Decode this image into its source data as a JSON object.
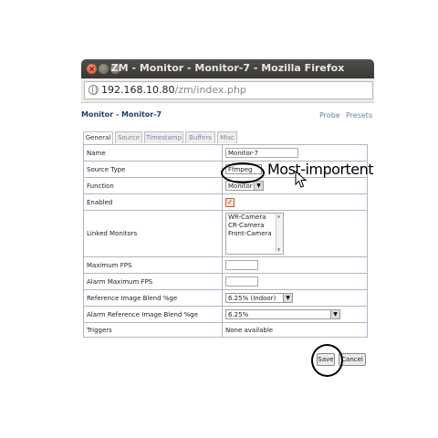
{
  "window": {
    "title": "ZM - Monitor - Monitor-7 - Mozilla Firefox",
    "url_host": "192.168.10.80",
    "url_path": "/zm/index.php"
  },
  "page": {
    "title": "Monitor - Monitor-7",
    "links": {
      "probe": "Probe",
      "presets": "Presets"
    }
  },
  "tabs": [
    "General",
    "Source",
    "Timestamp",
    "Buffers",
    "Misc"
  ],
  "form": {
    "name": {
      "label": "Name",
      "value": "Monitor-7"
    },
    "source_type": {
      "label": "Source Type",
      "value": "Ffmpeg"
    },
    "function": {
      "label": "Function",
      "value": "Monitor"
    },
    "enabled": {
      "label": "Enabled",
      "checked": true
    },
    "linked": {
      "label": "Linked Monitors",
      "options": [
        "WR-Camera",
        "CR-Camera",
        "Front-Camera"
      ]
    },
    "max_fps": {
      "label": "Maximum FPS",
      "value": ""
    },
    "alarm_max_fps": {
      "label": "Alarm Maximum FPS",
      "value": ""
    },
    "ref_blend": {
      "label": "Reference Image Blend %ge",
      "value": "6.25% (Indoor)"
    },
    "alarm_ref_blend": {
      "label": "Alarm Reference Image Blend %ge",
      "value": "6.25%"
    },
    "triggers": {
      "label": "Triggers",
      "value": "None available"
    }
  },
  "buttons": {
    "save": "Save",
    "cancel": "Cancel"
  },
  "annotation": {
    "note": "Most-importent"
  },
  "colors": {
    "title_text": "#1f3d6e",
    "link": "#6f7fa6",
    "titlebar": "#3a3935",
    "close_button": "#d6512d"
  },
  "icons": {
    "close": "close-icon",
    "minimize": "minimize-icon",
    "maximize": "maximize-icon",
    "site": "globe-icon",
    "cursor": "mouse-cursor-icon"
  }
}
